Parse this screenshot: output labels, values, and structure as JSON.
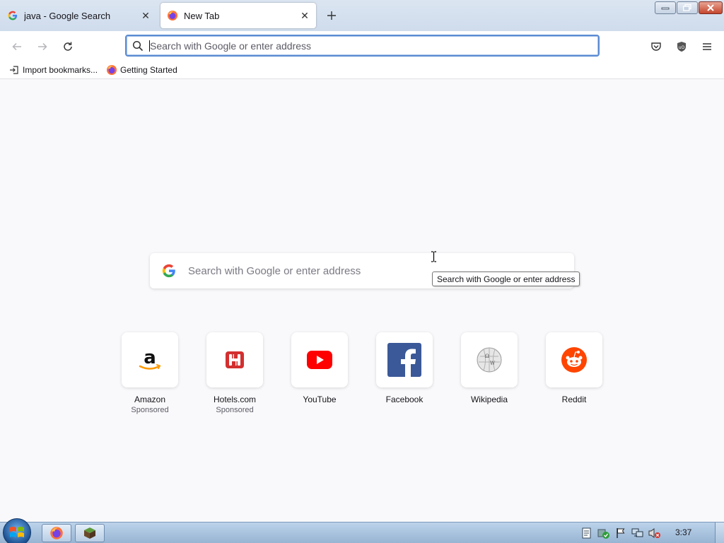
{
  "tabs": [
    {
      "title": "java - Google Search",
      "icon": "google-g-icon",
      "active": false
    },
    {
      "title": "New Tab",
      "icon": "firefox-icon",
      "active": true
    }
  ],
  "url_bar": {
    "placeholder": "Search with Google or enter address",
    "value": ""
  },
  "bookmarks": [
    {
      "label": "Import bookmarks...",
      "icon": "import-icon"
    },
    {
      "label": "Getting Started",
      "icon": "firefox-icon"
    }
  ],
  "content_search": {
    "placeholder": "Search with Google or enter address",
    "tooltip": "Search with Google or enter address"
  },
  "top_sites": [
    {
      "label": "Amazon",
      "sponsored": "Sponsored",
      "icon": "amazon-icon"
    },
    {
      "label": "Hotels.com",
      "sponsored": "Sponsored",
      "icon": "hotels-icon"
    },
    {
      "label": "YouTube",
      "sponsored": "",
      "icon": "youtube-icon"
    },
    {
      "label": "Facebook",
      "sponsored": "",
      "icon": "facebook-icon"
    },
    {
      "label": "Wikipedia",
      "sponsored": "",
      "icon": "wikipedia-icon"
    },
    {
      "label": "Reddit",
      "sponsored": "",
      "icon": "reddit-icon"
    }
  ],
  "taskbar": {
    "clock": "3:37"
  },
  "colors": {
    "accent": "#5b8bd2",
    "youtube": "#ff0000",
    "facebook": "#3b5998",
    "reddit": "#ff4500",
    "hotels": "#d32f2f"
  }
}
